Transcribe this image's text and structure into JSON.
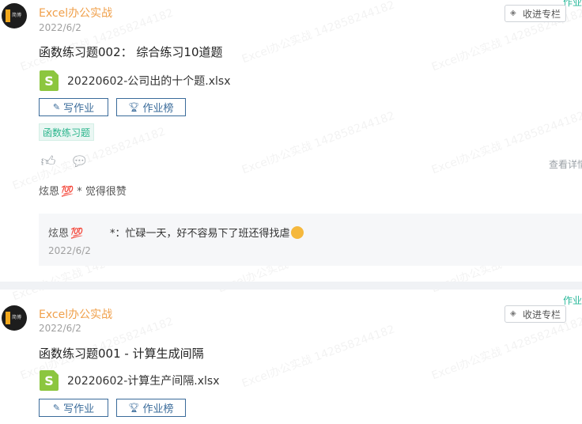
{
  "posts": [
    {
      "author": "Excel办公实战",
      "avatar_text": "简博",
      "date": "2022/6/2",
      "favorite_label": "收进专栏",
      "corner_tag": "作业",
      "title": "函数练习题002：  综合练习10道题",
      "file_name": "20220602-公司出的十个题.xlsx",
      "file_icon_letter": "S",
      "write_label": "写作业",
      "rank_label": "作业榜",
      "topic_tag": "函数练习题",
      "detail_label": "查看详情",
      "likes": {
        "name": "炫恩",
        "emoji": "💯",
        "suffix": "* 觉得很赞"
      },
      "comment": {
        "name": "炫恩",
        "emoji": "💯",
        "text": "*：忙碌一天，好不容易下了班还得找虐",
        "date": "2022/6/2"
      }
    },
    {
      "author": "Excel办公实战",
      "avatar_text": "简博",
      "date": "2022/6/2",
      "favorite_label": "收进专栏",
      "corner_tag": "作业",
      "title": "函数练习题001 - 计算生成间隔",
      "file_name": "20220602-计算生产间隔.xlsx",
      "file_icon_letter": "S",
      "write_label": "写作业",
      "rank_label": "作业榜"
    }
  ],
  "watermark_text": "Excel办公实战 142858244182",
  "colors": {
    "author": "#f0a04b",
    "button_border": "#3a6b9a",
    "tag_green": "#2bb58c"
  }
}
